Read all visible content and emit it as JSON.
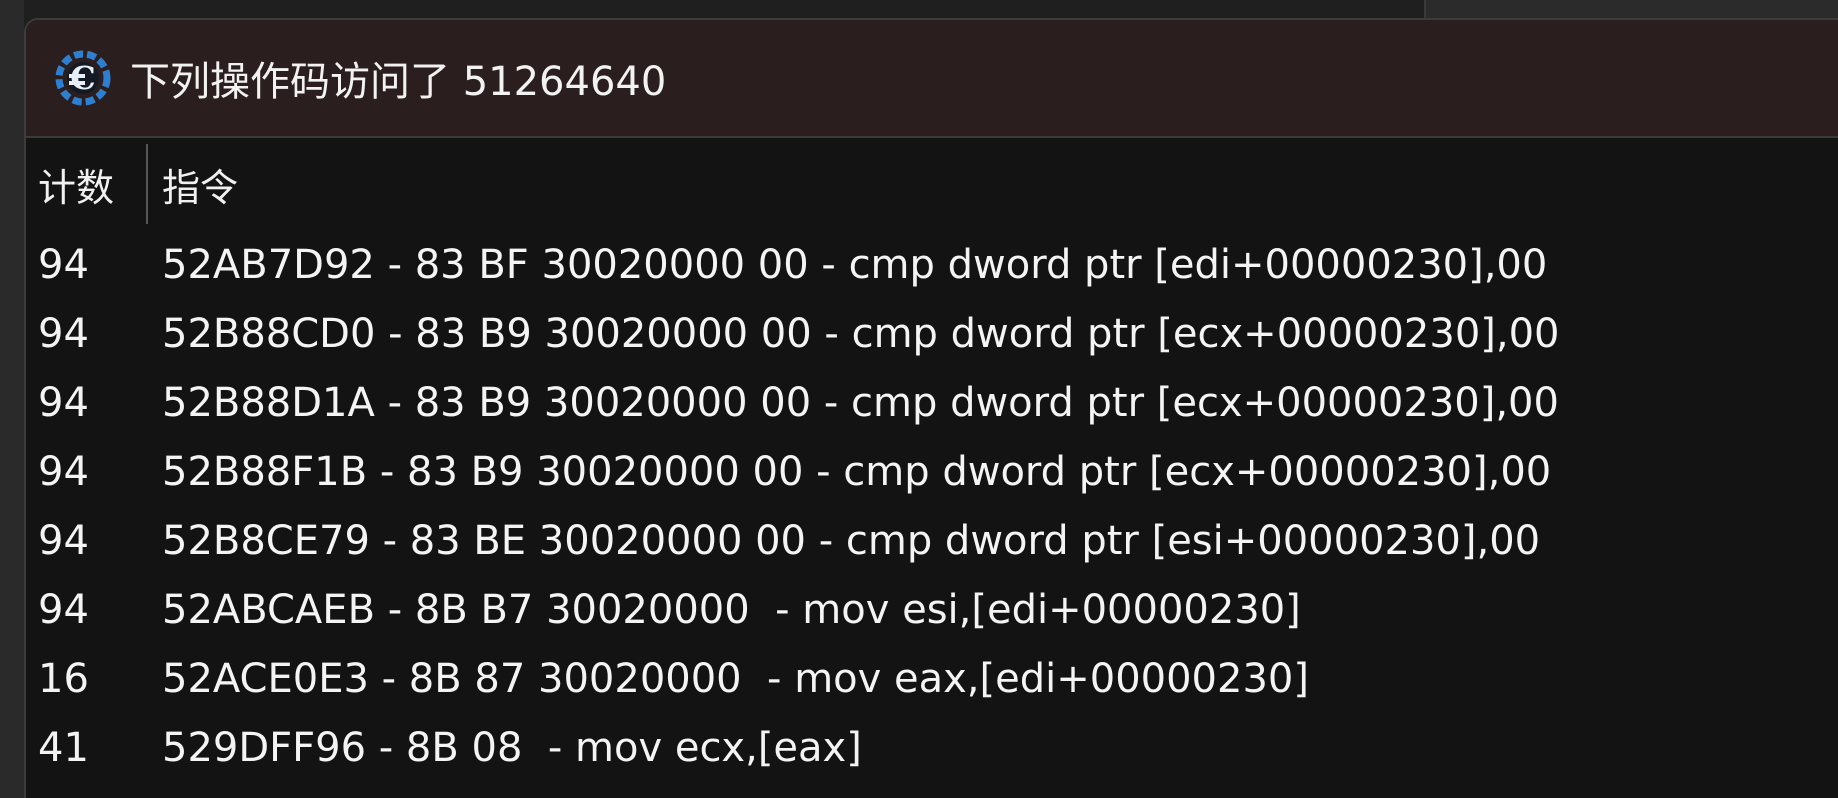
{
  "window": {
    "title": "下列操作码访问了 51264640",
    "icon": "cheat-engine-icon"
  },
  "table": {
    "columns": [
      "计数",
      "指令"
    ],
    "rows": [
      {
        "count": "94",
        "instruction": "52AB7D92 - 83 BF 30020000 00 - cmp dword ptr [edi+00000230],00"
      },
      {
        "count": "94",
        "instruction": "52B88CD0 - 83 B9 30020000 00 - cmp dword ptr [ecx+00000230],00"
      },
      {
        "count": "94",
        "instruction": "52B88D1A - 83 B9 30020000 00 - cmp dword ptr [ecx+00000230],00"
      },
      {
        "count": "94",
        "instruction": "52B88F1B - 83 B9 30020000 00 - cmp dword ptr [ecx+00000230],00"
      },
      {
        "count": "94",
        "instruction": "52B8CE79 - 83 BE 30020000 00 - cmp dword ptr [esi+00000230],00"
      },
      {
        "count": "94",
        "instruction": "52ABCAEB - 8B B7 30020000  - mov esi,[edi+00000230]"
      },
      {
        "count": "16",
        "instruction": "52ACE0E3 - 8B 87 30020000  - mov eax,[edi+00000230]"
      },
      {
        "count": "41",
        "instruction": "529DFF96 - 8B 08  - mov ecx,[eax]"
      }
    ]
  },
  "colors": {
    "titlebar_bg": "#2a1e1e",
    "window_bg": "#131313",
    "text": "#f4f4f4",
    "icon_blue": "#2f7fd0"
  }
}
